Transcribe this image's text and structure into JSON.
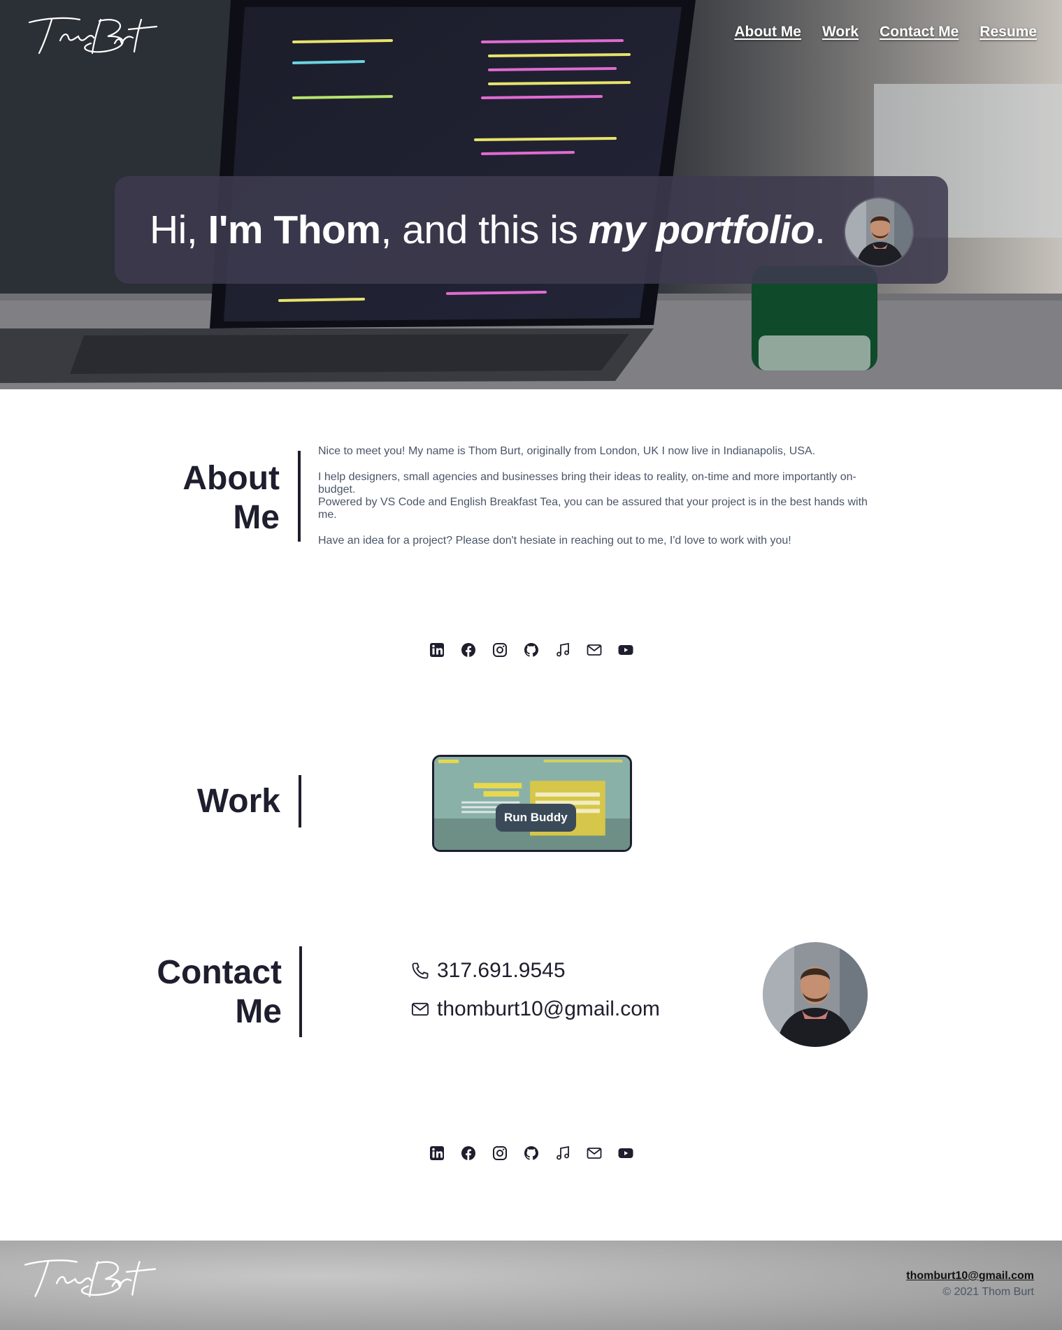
{
  "brand": {
    "logo_text": "Thom Burt"
  },
  "nav": {
    "items": [
      "About Me",
      "Work",
      "Contact Me",
      "Resume"
    ]
  },
  "hero": {
    "greeting": "Hi, ",
    "name": "I'm Thom",
    "middle": ", and this is ",
    "highlight": "my portfolio",
    "end": "."
  },
  "about": {
    "title_line1": "About",
    "title_line2": "Me",
    "paragraphs": [
      "Nice to meet you! My name is Thom Burt, originally from London, UK I now live in Indianapolis, USA.",
      "I help designers, small agencies and businesses bring their ideas to reality, on-time and more importantly on-budget.",
      "Powered by VS Code and English Breakfast Tea, you can be assured that your project is in the best hands with me.",
      "Have an idea for a project? Please don't hesiate in reaching out to me, I'd love to work with you!"
    ]
  },
  "socials": [
    "linkedin-icon",
    "facebook-icon",
    "instagram-icon",
    "github-icon",
    "music-icon",
    "mail-icon",
    "youtube-icon"
  ],
  "work": {
    "title": "Work",
    "projects": [
      {
        "name": "Run Buddy"
      }
    ]
  },
  "contact": {
    "title_line1": "Contact",
    "title_line2": "Me",
    "phone": "317.691.9545",
    "email": "thomburt10@gmail.com"
  },
  "footer": {
    "email": "thomburt10@gmail.com",
    "copyright": "© 2021 Thom Burt"
  },
  "colors": {
    "text_dark": "#1e1e2e",
    "banner": "#3e3a4e",
    "body_text": "#4a5568"
  }
}
